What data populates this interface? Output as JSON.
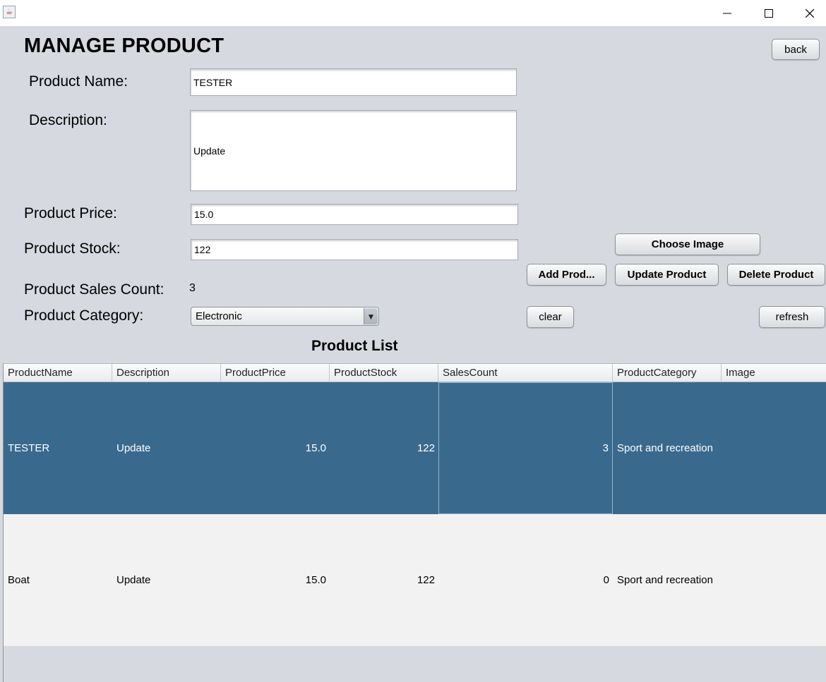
{
  "window": {
    "app_icon": "java-coffee-icon",
    "controls": [
      "minimize-icon",
      "maximize-icon",
      "close-icon"
    ]
  },
  "page": {
    "title": "MANAGE PRODUCT",
    "back_label": "back"
  },
  "form": {
    "name_label": "Product Name:",
    "name_value": "TESTER",
    "description_label": "Description:",
    "description_value": "Update",
    "price_label": "Product Price:",
    "price_value": "15.0",
    "stock_label": "Product Stock:",
    "stock_value": "122",
    "sales_label": "Product Sales Count:",
    "sales_value": "3",
    "category_label": "Product Category:",
    "category_selected": "Electronic"
  },
  "actions": {
    "choose_image": "Choose Image",
    "add": "Add Prod...",
    "update": "Update Product",
    "delete": "Delete Product",
    "clear": "clear",
    "refresh": "refresh"
  },
  "table": {
    "title": "Product List",
    "columns": [
      "ProductName",
      "Description",
      "ProductPrice",
      "ProductStock",
      "SalesCount",
      "ProductCategory",
      "Image"
    ],
    "rows": [
      {
        "name": "TESTER",
        "description": "Update",
        "price": "15.0",
        "stock": "122",
        "sales": "3",
        "category": "Sport and recreation",
        "image": "",
        "selected": true
      },
      {
        "name": "Boat",
        "description": "Update",
        "price": "15.0",
        "stock": "122",
        "sales": "0",
        "category": "Sport and recreation",
        "image": "",
        "selected": false
      }
    ]
  },
  "colors": {
    "background": "#d6d9df",
    "selection": "#396a8e"
  }
}
